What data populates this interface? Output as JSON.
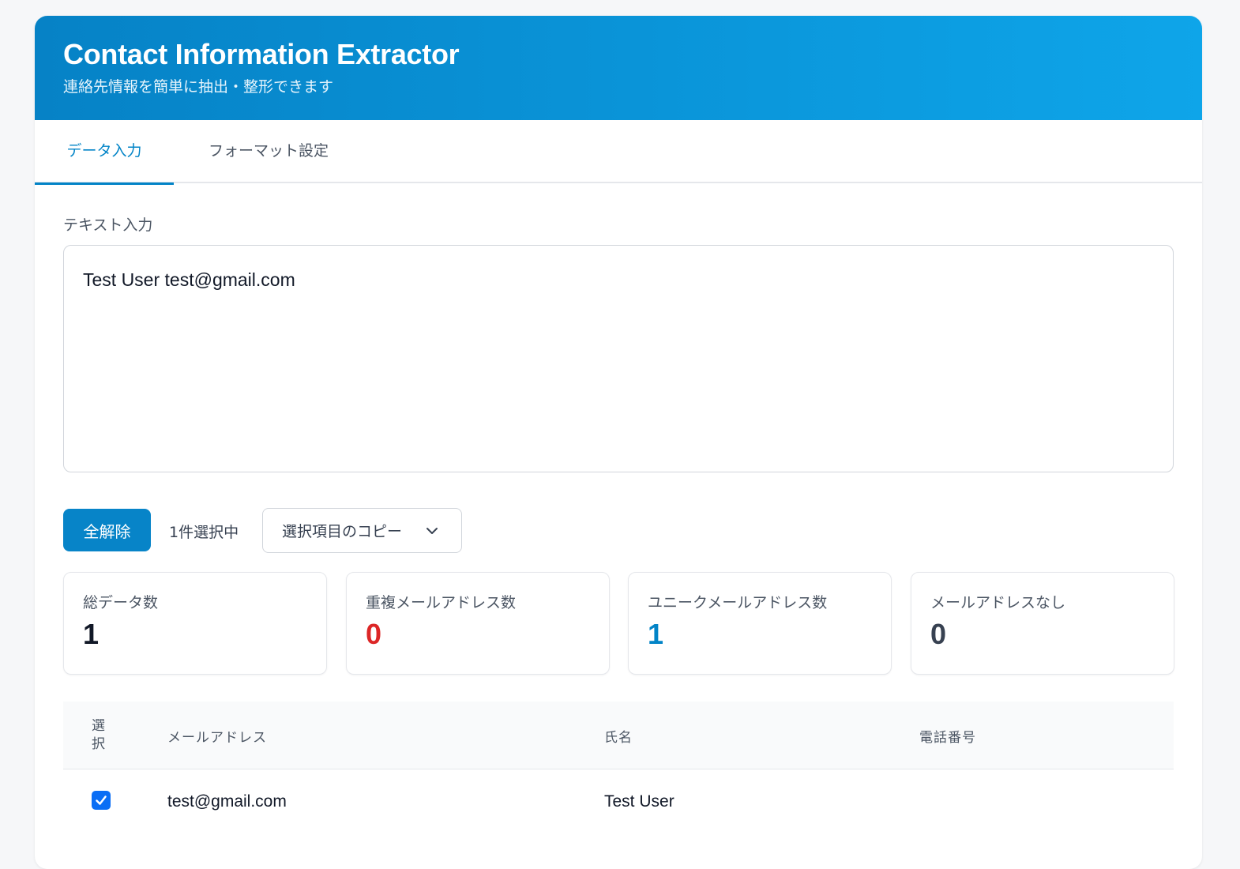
{
  "header": {
    "title": "Contact Information Extractor",
    "subtitle": "連絡先情報を簡単に抽出・整形できます"
  },
  "tabs": [
    {
      "label": "データ入力",
      "active": true
    },
    {
      "label": "フォーマット設定",
      "active": false
    }
  ],
  "input": {
    "label": "テキスト入力",
    "value": "Test User test@gmail.com"
  },
  "actions": {
    "clear_all_label": "全解除",
    "selected_count": "1件選択中",
    "copy_selected_label": "選択項目のコピー",
    "copy_icon": "chevron-down-icon"
  },
  "stats": [
    {
      "label": "総データ数",
      "value": "1",
      "color": "#111827"
    },
    {
      "label": "重複メールアドレス数",
      "value": "0",
      "color": "#dc2626"
    },
    {
      "label": "ユニークメールアドレス数",
      "value": "1",
      "color": "#0284c7"
    },
    {
      "label": "メールアドレスなし",
      "value": "0",
      "color": "#374151"
    }
  ],
  "table": {
    "columns": {
      "select_line1": "選",
      "select_line2": "択",
      "email": "メールアドレス",
      "name": "氏名",
      "phone": "電話番号"
    },
    "rows": [
      {
        "selected": true,
        "email": "test@gmail.com",
        "name": "Test User",
        "phone": ""
      }
    ]
  },
  "colors": {
    "accent": "#0284c7",
    "header_gradient_start": "#0682c6",
    "header_gradient_end": "#0ea5e9",
    "checkbox": "#0a6ef5"
  }
}
